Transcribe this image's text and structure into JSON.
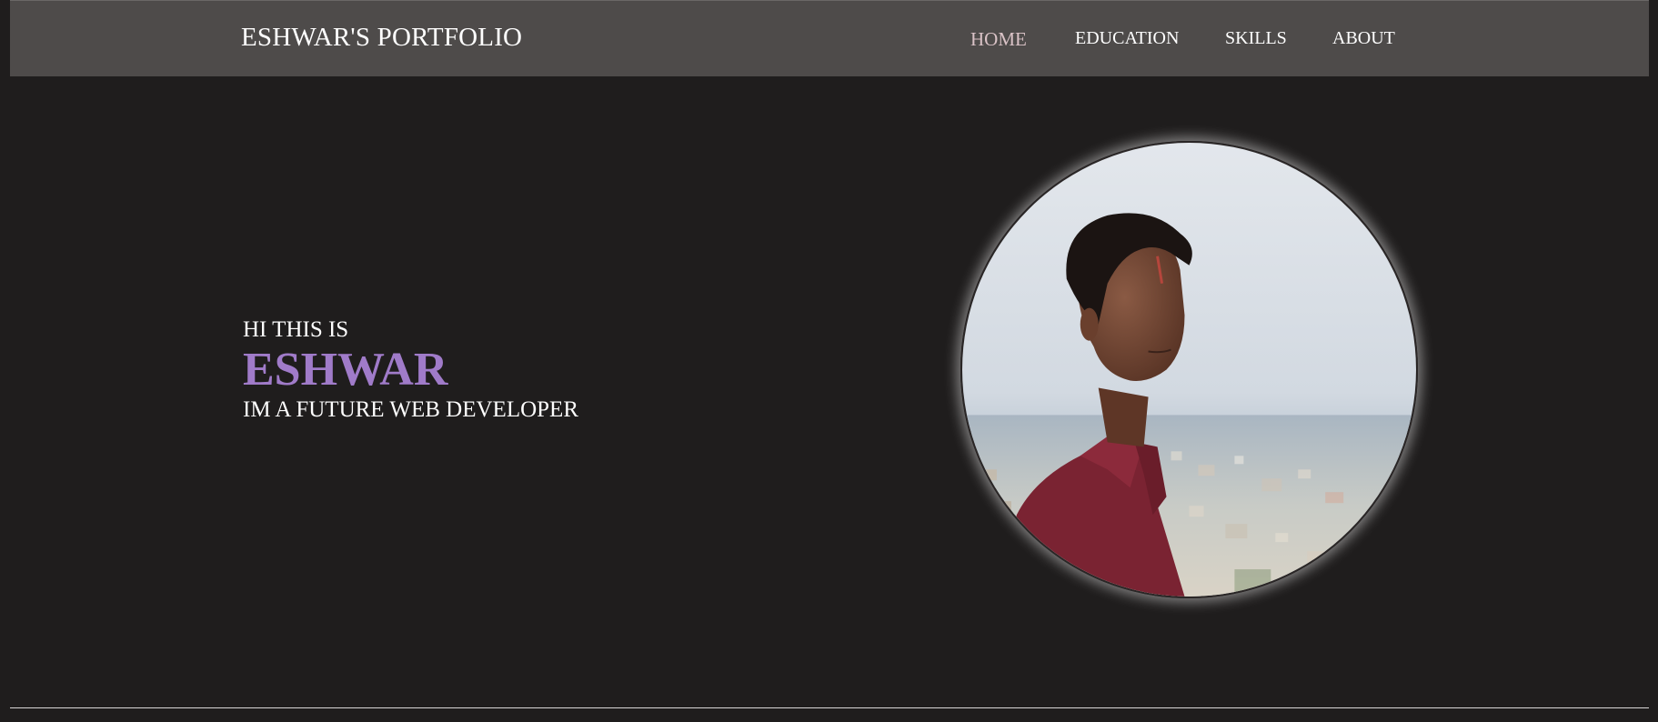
{
  "header": {
    "brand": "ESHWAR'S PORTFOLIO",
    "nav": [
      {
        "label": "HOME",
        "active": true
      },
      {
        "label": "EDUCATION",
        "active": false
      },
      {
        "label": "SKILLS",
        "active": false
      },
      {
        "label": "ABOUT",
        "active": false
      }
    ]
  },
  "hero": {
    "greeting": "HI THIS IS",
    "name": "ESHWAR",
    "tagline": "IM A FUTURE WEB DEVELOPER"
  },
  "colors": {
    "background": "#1f1d1d",
    "navbar": "#4e4b4a",
    "accent": "#a07bc9",
    "active_nav": "#d9c2c6",
    "text": "#ffffff"
  }
}
